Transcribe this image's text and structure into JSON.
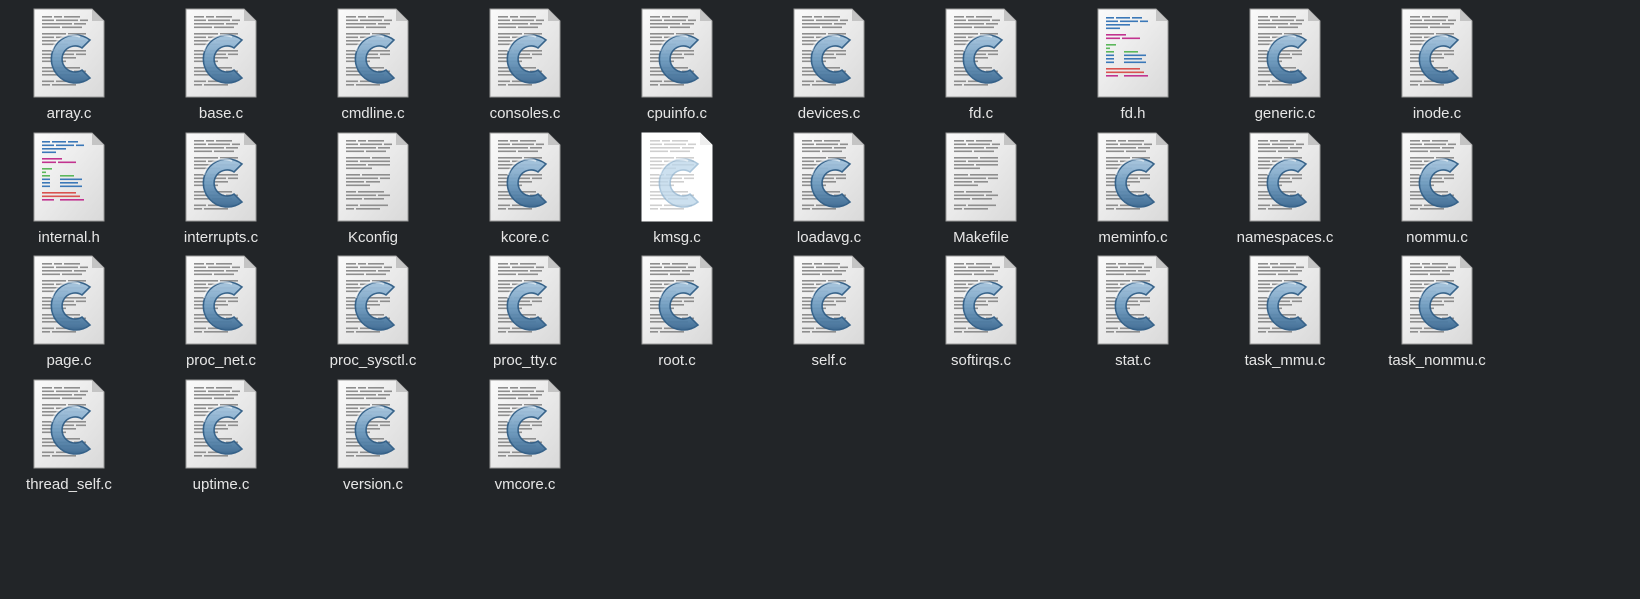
{
  "view": {
    "files": [
      {
        "name": "array.c",
        "type": "c-source"
      },
      {
        "name": "base.c",
        "type": "c-source"
      },
      {
        "name": "cmdline.c",
        "type": "c-source"
      },
      {
        "name": "consoles.c",
        "type": "c-source"
      },
      {
        "name": "cpuinfo.c",
        "type": "c-source"
      },
      {
        "name": "devices.c",
        "type": "c-source"
      },
      {
        "name": "fd.c",
        "type": "c-source"
      },
      {
        "name": "fd.h",
        "type": "c-header"
      },
      {
        "name": "generic.c",
        "type": "c-source"
      },
      {
        "name": "inode.c",
        "type": "c-source"
      },
      {
        "name": "internal.h",
        "type": "c-header"
      },
      {
        "name": "interrupts.c",
        "type": "c-source"
      },
      {
        "name": "Kconfig",
        "type": "text"
      },
      {
        "name": "kcore.c",
        "type": "c-source"
      },
      {
        "name": "kmsg.c",
        "type": "c-source",
        "selected": true
      },
      {
        "name": "loadavg.c",
        "type": "c-source"
      },
      {
        "name": "Makefile",
        "type": "text"
      },
      {
        "name": "meminfo.c",
        "type": "c-source"
      },
      {
        "name": "namespaces.c",
        "type": "c-source"
      },
      {
        "name": "nommu.c",
        "type": "c-source"
      },
      {
        "name": "page.c",
        "type": "c-source"
      },
      {
        "name": "proc_net.c",
        "type": "c-source"
      },
      {
        "name": "proc_sysctl.c",
        "type": "c-source"
      },
      {
        "name": "proc_tty.c",
        "type": "c-source"
      },
      {
        "name": "root.c",
        "type": "c-source"
      },
      {
        "name": "self.c",
        "type": "c-source"
      },
      {
        "name": "softirqs.c",
        "type": "c-source"
      },
      {
        "name": "stat.c",
        "type": "c-source"
      },
      {
        "name": "task_mmu.c",
        "type": "c-source"
      },
      {
        "name": "task_nommu.c",
        "type": "c-source"
      },
      {
        "name": "thread_self.c",
        "type": "c-source"
      },
      {
        "name": "uptime.c",
        "type": "c-source"
      },
      {
        "name": "version.c",
        "type": "c-source"
      },
      {
        "name": "vmcore.c",
        "type": "c-source"
      }
    ]
  },
  "icons": {
    "c-source": "c-source-file-icon",
    "c-header": "c-header-file-icon",
    "text": "text-file-icon"
  },
  "colors": {
    "background": "#222528",
    "label": "#e6e6e6",
    "c_letter": "#6f9cc0",
    "c_letter_dark": "#3c6a93"
  }
}
